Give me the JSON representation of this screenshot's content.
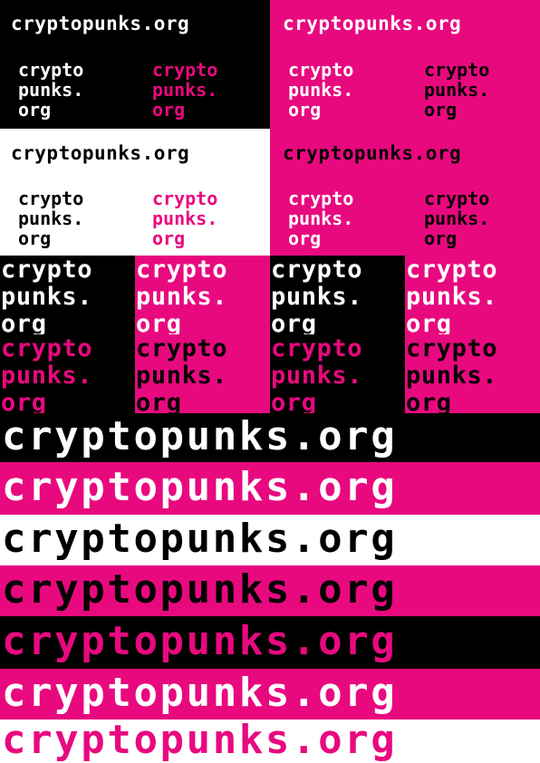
{
  "domain_text": "cryptopunks.org",
  "colors": {
    "black": "#000000",
    "magenta": "#e8097f",
    "white": "#ffffff"
  },
  "top": {
    "q1_line": "cryptopunks.org",
    "q1_stack_left": [
      "crypto",
      "punks.",
      "org"
    ],
    "q1_stack_right": [
      "crypto",
      "punks.",
      "org"
    ],
    "q2_line": "cryptopunks.org",
    "q2_stack_left": [
      "crypto",
      "punks.",
      "org"
    ],
    "q2_stack_right": [
      "crypto",
      "punks.",
      "org"
    ],
    "q3_line": "cryptopunks.org",
    "q3_stack_left": [
      "crypto",
      "punks.",
      "org"
    ],
    "q3_stack_right": [
      "crypto",
      "punks.",
      "org"
    ],
    "q4_line": "cryptopunks.org",
    "q4_stack_left": [
      "crypto",
      "punks.",
      "org"
    ],
    "q4_stack_right": [
      "crypto",
      "punks.",
      "org"
    ]
  },
  "grid": {
    "word_lines": [
      "crypto",
      "punks.",
      "org"
    ]
  },
  "bands": [
    {
      "text": "cryptopunks.org"
    },
    {
      "text": "cryptopunks.org"
    },
    {
      "text": "cryptopunks.org"
    },
    {
      "text": "cryptopunks.org"
    },
    {
      "text": "cryptopunks.org"
    },
    {
      "text": "cryptopunks.org"
    },
    {
      "text": "cryptopunks.org"
    }
  ]
}
